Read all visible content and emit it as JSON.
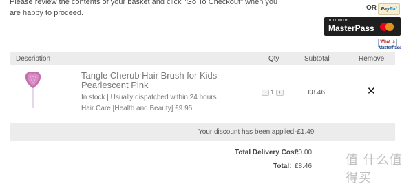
{
  "intro_text": "Please review the contents of your basket and click \"Go To Checkout\" when you are happy to proceed.",
  "payment": {
    "or_label": "OR",
    "paypal_part1": "Pay",
    "paypal_part2": "Pal",
    "masterpass_top": "BUY WITH",
    "masterpass_name": "MasterPass",
    "masterpass_link_part1": "What is",
    "masterpass_link_part2": "MasterPass"
  },
  "table": {
    "headers": {
      "description": "Description",
      "qty": "Qty",
      "subtotal": "Subtotal",
      "remove": "Remove"
    }
  },
  "item": {
    "name": "Tangle Cherub Hair Brush for Kids - Pearlescent Pink",
    "stock": "In stock | Usually dispatched within 24 hours",
    "category": "Hair Care [Health and Beauty] £9.95",
    "qty": "1",
    "qty_minus": "-",
    "qty_plus": "+",
    "subtotal": "£8.46",
    "remove_symbol": "✕"
  },
  "discount": {
    "label": "Your discount has been applied:",
    "value": "-£1.49"
  },
  "totals": {
    "delivery_label": "Total Delivery Cost:",
    "delivery_value": "£0.00",
    "total_label": "Total:",
    "total_value": "£8.46"
  },
  "watermark": {
    "text": "值 什么值得买"
  },
  "colors": {
    "header_bg": "#ececec",
    "masterpass_bg": "#1f1f1f",
    "brush_pink": "#c46fae"
  }
}
